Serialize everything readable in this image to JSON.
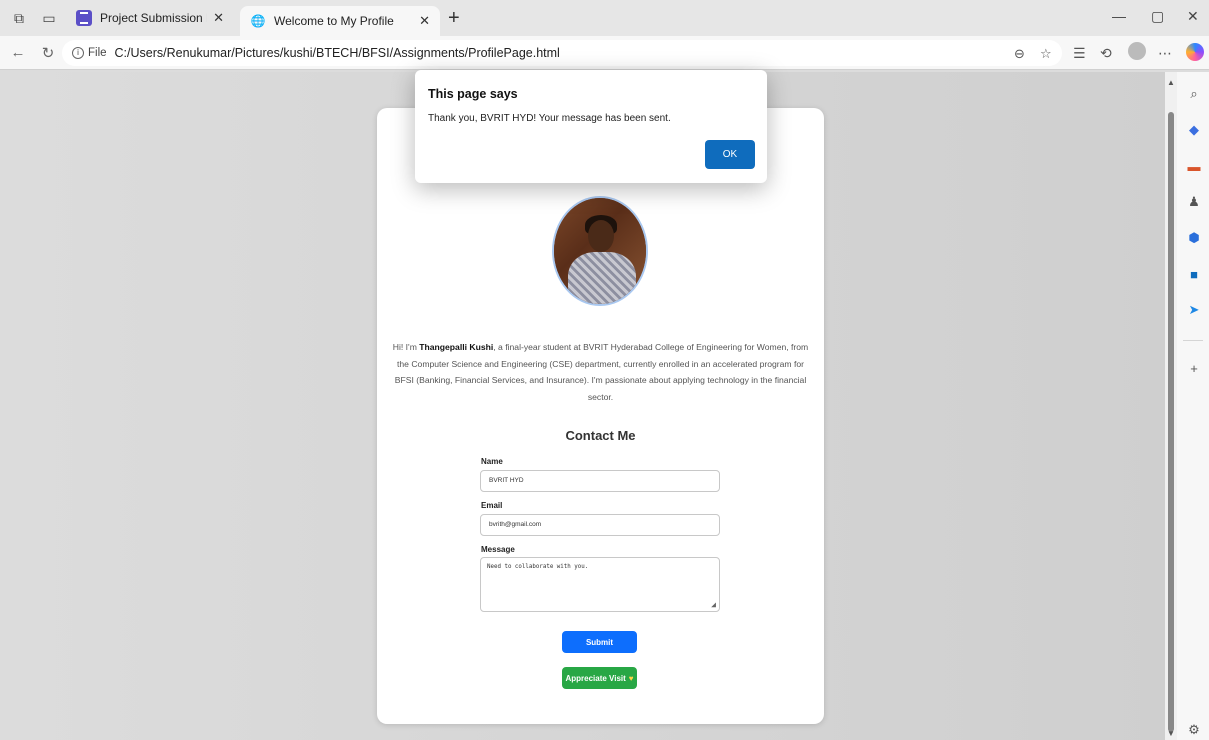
{
  "browser": {
    "tabs": [
      {
        "title": "Project Submission Form (HTML,",
        "active": false,
        "favicon": "form-icon"
      },
      {
        "title": "Welcome to My Profile",
        "active": true,
        "favicon": "globe-icon"
      }
    ],
    "address": {
      "chip": "File",
      "url": "C:/Users/Renukumar/Pictures/kushi/BTECH/BFSI/Assignments/ProfilePage.html"
    }
  },
  "profile": {
    "bio_prefix": "Hi! I'm ",
    "bio_name": "Thangepalli Kushi",
    "bio_rest": ", a final-year student at BVRIT Hyderabad College of Engineering for Women, from the Computer Science and Engineering (CSE) department, currently enrolled in an accelerated program for BFSI (Banking, Financial Services, and Insurance). I'm passionate about applying technology in the financial sector."
  },
  "contact": {
    "title": "Contact Me",
    "name_label": "Name",
    "name_value": "BVRIT HYD",
    "email_label": "Email",
    "email_value": "bvrith@gmail.com",
    "message_label": "Message",
    "message_value": "Need to collaborate with you.",
    "submit_label": "Submit",
    "appreciate_label": "Appreciate Visit"
  },
  "dialog": {
    "title": "This page says",
    "message": "Thank you, BVRIT HYD! Your message has been sent.",
    "ok_label": "OK"
  },
  "colors": {
    "submit": "#0d6efd",
    "appreciate": "#28a745",
    "dialog_ok": "#0f6cbd"
  }
}
